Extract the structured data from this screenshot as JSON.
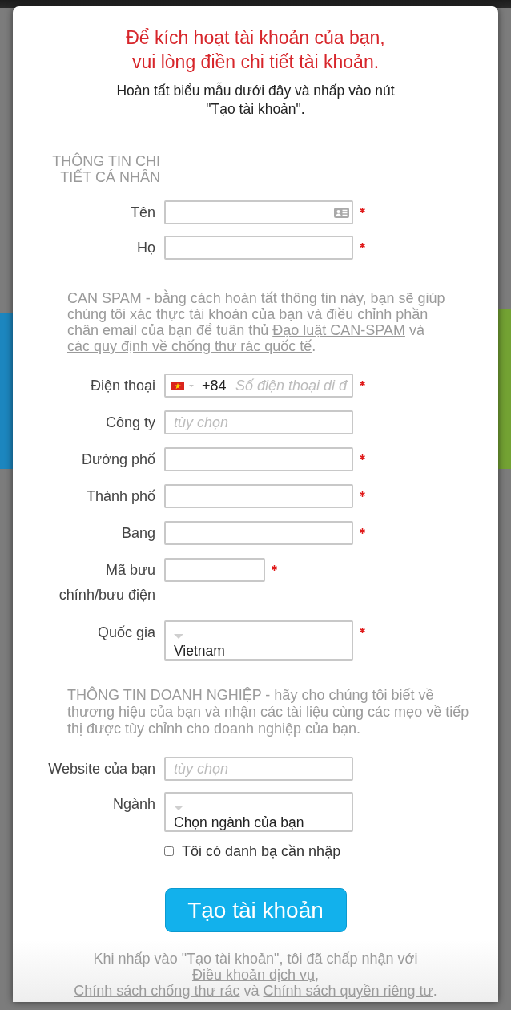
{
  "header": {
    "title_lines": [
      "Để kích hoạt tài khoản của bạn,",
      "vui lòng điền chi tiết tài khoản."
    ],
    "subtitle_lines": [
      "Hoàn tất biểu mẫu dưới đây và nhấp vào nút",
      "\"Tạo tài khoản\"."
    ]
  },
  "personal_section": {
    "heading": "THÔNG TIN CHI TIẾT CÁ NHÂN",
    "fields": [
      {
        "label": "Tên",
        "kind": "text",
        "required": true,
        "contact_icon": true
      },
      {
        "label": "Họ",
        "kind": "text",
        "required": true,
        "contact_icon": false
      }
    ]
  },
  "can_spam_notice": {
    "segments": [
      {
        "kind": "text",
        "text": "CAN SPAM - bằng cách hoàn tất thông tin này, bạn sẽ giúp chúng tôi xác thực tài khoản của bạn và điều chỉnh phần chân email của bạn để tuân thủ "
      },
      {
        "kind": "link",
        "text": "Đạo luật CAN-SPAM"
      },
      {
        "kind": "text",
        "text": " và "
      },
      {
        "kind": "link",
        "text": "các quy định về chống thư rác quốc tế"
      },
      {
        "kind": "text",
        "text": "."
      }
    ]
  },
  "contact_fields": [
    {
      "label": "Điện thoại",
      "kind": "phone",
      "dial_code": "+84",
      "placeholder": "Số điện thoại di đ",
      "required": true
    },
    {
      "label": "Công ty",
      "kind": "text",
      "placeholder": "tùy chọn",
      "required": false
    },
    {
      "label": "Đường phố",
      "kind": "text",
      "required": true
    },
    {
      "label": "Thành phố",
      "kind": "text",
      "required": true
    },
    {
      "label": "Bang",
      "kind": "text",
      "required": true
    },
    {
      "label": "Mã bưu chính/bưu điện",
      "kind": "short",
      "required": true
    },
    {
      "label": "Quốc gia",
      "kind": "select",
      "value": "Vietnam",
      "required": true
    }
  ],
  "business_notice": "THÔNG TIN DOANH NGHIỆP - hãy cho chúng tôi biết về thương hiệu của bạn và nhận các tài liệu cùng các mẹo về tiếp thị được tùy chỉnh cho doanh nghiệp của bạn.",
  "business_fields": [
    {
      "label": "Website của bạn",
      "kind": "text",
      "placeholder": "tùy chọn",
      "required": false
    },
    {
      "label": "Ngành",
      "kind": "select",
      "value": "Chọn ngành của bạn",
      "required": false
    }
  ],
  "import_checkbox": {
    "label": "Tôi có danh bạ cần nhập",
    "checked": false
  },
  "submit_button": "Tạo tài khoản",
  "terms_notice": {
    "segments": [
      {
        "kind": "text",
        "text": "Khi nhấp vào \"Tạo tài khoản\", tôi đã chấp nhận với "
      },
      {
        "kind": "link",
        "text": "Điều khoản dịch vụ"
      },
      {
        "kind": "text",
        "text": ","
      },
      {
        "kind": "break"
      },
      {
        "kind": "link",
        "text": "Chính sách chống thư rác"
      },
      {
        "kind": "text",
        "text": " và "
      },
      {
        "kind": "link",
        "text": "Chính sách quyền riêng tư"
      },
      {
        "kind": "text",
        "text": "."
      }
    ]
  }
}
